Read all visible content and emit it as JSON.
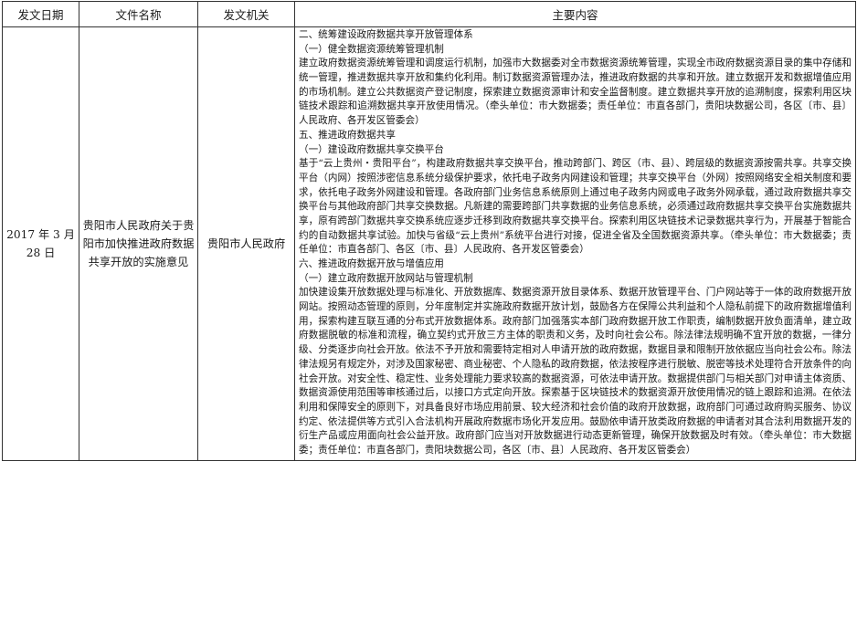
{
  "headers": {
    "date": "发文日期",
    "name": "文件名称",
    "issuer": "发文机关",
    "content": "主要内容"
  },
  "row": {
    "date": "2017 年 3 月 28 日",
    "name": "贵阳市人民政府关于贵阳市加快推进政府数据共享开放的实施意见",
    "issuer": "贵阳市人民政府",
    "content": [
      "二、统筹建设政府数据共享开放管理体系",
      "（一）健全数据资源统筹管理机制",
      "建立政府数据资源统筹管理和调度运行机制，加强市大数据委对全市数据资源统筹管理，实现全市政府数据资源目录的集中存储和统一管理，推进数据共享开放和集约化利用。制订数据资源管理办法，推进政府数据的共享和开放。建立数据开发和数据增值应用的市场机制。建立公共数据资产登记制度，探索建立数据资源审计和安全监督制度。建立数据共享开放的追溯制度，探索利用区块链技术跟踪和追溯数据共享开放使用情况。（牵头单位：市大数据委；责任单位：市直各部门，贵阳块数据公司，各区〔市、县〕人民政府、各开发区管委会）",
      "五、推进政府数据共享",
      "（一）建设政府数据共享交换平台",
      "基于“云上贵州・贵阳平台”，构建政府数据共享交换平台，推动跨部门、跨区（市、县）、跨层级的数据资源按需共享。共享交换平台（内网）按照涉密信息系统分级保护要求，依托电子政务内网建设和管理；共享交换平台（外网）按照网络安全相关制度和要求，依托电子政务外网建设和管理。各政府部门业务信息系统原则上通过电子政务内网或电子政务外网承载，通过政府数据共享交换平台与其他政府部门共享交换数据。凡新建的需要跨部门共享数据的业务信息系统，必须通过政府数据共享交换平台实施数据共享，原有跨部门数据共享交换系统应逐步迁移到政府数据共享交换平台。探索利用区块链技术记录数据共享行为，开展基于智能合约的自动数据共享试验。加快与省级“云上贵州”系统平台进行对接，促进全省及全国数据资源共享。（牵头单位：市大数据委；责任单位：市直各部门、各区〔市、县〕人民政府、各开发区管委会）",
      "六、推进政府数据开放与增值应用",
      "（一）建立政府数据开放网站与管理机制",
      "加快建设集开放数据处理与标准化、开放数据库、数据资源开放目录体系、数据开放管理平台、门户网站等于一体的政府数据开放网站。按照动态管理的原则，分年度制定并实施政府数据开放计划，鼓励各方在保障公共利益和个人隐私前提下的政府数据增值利用，探索构建互联互通的分布式开放数据体系。政府部门加强落实本部门政府数据开放工作职责，编制数据开放负面清单，建立政府数据脱敏的标准和流程，确立契约式开放三方主体的职责和义务，及时向社会公布。除法律法规明确不宜开放的数据，一律分级、分类逐步向社会开放。依法不予开放和需要特定相对人申请开放的政府数据，数据目录和限制开放依据应当向社会公布。除法律法规另有规定外，对涉及国家秘密、商业秘密、个人隐私的政府数据，依法按程序进行脱敏、脱密等技术处理符合开放条件的向社会开放。对安全性、稳定性、业务处理能力要求较高的数据资源，可依法申请开放。数据提供部门与相关部门对申请主体资质、数据资源使用范围等审核通过后，以接口方式定向开放。探索基于区块链技术的数据资源开放使用情况的链上跟踪和追溯。在依法利用和保障安全的原则下，对具备良好市场应用前景、较大经济和社会价值的政府开放数据，政府部门可通过政府购买服务、协议约定、依法提供等方式引入合法机构开展政府数据市场化开发应用。鼓励依申请开放类政府数据的申请者对其合法利用数据开发的衍生产品或应用面向社会公益开放。政府部门应当对开放数据进行动态更新管理，确保开放数据及时有效。（牵头单位：市大数据委；责任单位：市直各部门，贵阳块数据公司，各区〔市、县〕人民政府、各开发区管委会）"
    ]
  }
}
